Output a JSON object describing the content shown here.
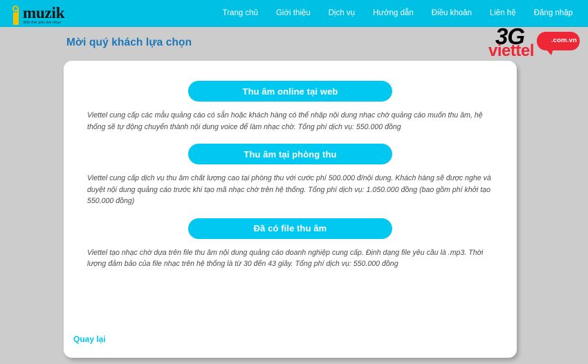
{
  "header": {
    "logo": {
      "word": "muzik",
      "tagline": "Một thế giới âm nhạc",
      "icon": "music-note-icon"
    },
    "nav": [
      {
        "label": "Trang chủ"
      },
      {
        "label": "Giới thiệu"
      },
      {
        "label": "Dịch vụ"
      },
      {
        "label": "Hướng dẫn"
      },
      {
        "label": "Điều khoản"
      },
      {
        "label": "Liên hệ"
      },
      {
        "label": "Đăng nhập"
      }
    ],
    "bg_color": "#00c1e4"
  },
  "page_title": "Mời quý khách lựa chọn",
  "brand_logo": {
    "three_g": "3G",
    "name": "viettel",
    "bubble_text": ".com.vn",
    "red": "#ee2737"
  },
  "card": {
    "options": [
      {
        "button_label": "Thu âm online tại web",
        "description": "Viettel cung cấp các mẫu quảng cáo có sẵn hoặc khách hàng có thể nhập nội dung nhạc chờ quảng cáo muốn thu âm, hệ thống sẽ tự động chuyển thành nội dung voice để làm nhạc chờ. Tổng phí dịch vụ: 550.000 đồng"
      },
      {
        "button_label": "Thu âm tại phòng thu",
        "description": "Viettel cung cấp dịch vụ thu âm chất lượng cao tại phòng thu với cước phí 500.000 đ/nội dung. Khách hàng sẽ được nghe và duyệt nội dung quảng cáo trước khi tạo mã nhạc chờ trên hệ thống. Tổng phí dịch vụ: 1.050.000 đồng (bao gồm phí khởi tạo 550.000 đồng)"
      },
      {
        "button_label": "Đã có file thu âm",
        "description": "Viettel tạo nhạc chờ dựa trên file thu âm nội dung quảng cáo doanh nghiệp cung cấp. Định dạng file yêu cầu là .mp3. Thời lượng đảm bảo của file nhạc trên hệ thống là từ 30 đến 43 giây. Tổng phí dịch vụ: 550.000 đồng"
      }
    ],
    "back_label": "Quay lại",
    "accent_color": "#00c8f0"
  }
}
